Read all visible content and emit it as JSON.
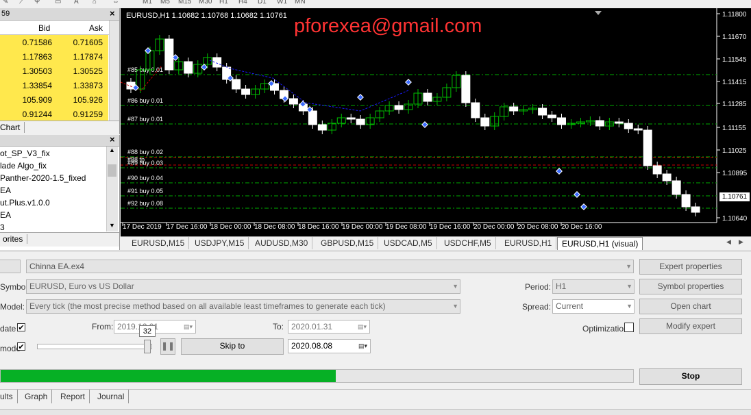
{
  "toolbar": {
    "items": [
      "M1",
      "M5",
      "M15",
      "M30",
      "H1",
      "H4",
      "D1",
      "W1",
      "MN"
    ]
  },
  "market_watch": {
    "title_fragment": "59",
    "col_bid": "Bid",
    "col_ask": "Ask",
    "rows": [
      {
        "bid": "0.71586",
        "ask": "0.71605"
      },
      {
        "bid": "1.17863",
        "ask": "1.17874"
      },
      {
        "bid": "1.30503",
        "ask": "1.30525"
      },
      {
        "bid": "1.33854",
        "ask": "1.33873"
      },
      {
        "bid": "105.909",
        "ask": "105.926"
      },
      {
        "bid": "0.91244",
        "ask": "0.91259"
      }
    ],
    "tab_label": "Chart"
  },
  "navigator": {
    "items": [
      "ot_SP_V3_fix",
      "lade Algo_fix",
      "Panther-2020-1.5_fixed",
      "EA",
      "ut.Plus.v1.0.0",
      "EA",
      "3"
    ],
    "tab_label": "orites"
  },
  "chart": {
    "header": "EURUSD,H1  1.10682 1.10768 1.10682 1.10761",
    "watermark": "pforexea@gmail.com",
    "current_price": "1.10761",
    "price_labels": [
      "1.11800",
      "1.11670",
      "1.11545",
      "1.11415",
      "1.11285",
      "1.11155",
      "1.11025",
      "1.10895",
      "1.10640"
    ],
    "time_labels": [
      "17 Dec 2019",
      "17 Dec 16:00",
      "18 Dec 00:00",
      "18 Dec 08:00",
      "18 Dec 16:00",
      "19 Dec 00:00",
      "19 Dec 08:00",
      "19 Dec 16:00",
      "20 Dec 00:00",
      "20 Dec 08:00",
      "20 Dec 16:00"
    ],
    "order_labels": [
      "#85 buy 0.01",
      "#86 buy 0.01",
      "#87 buy 0.01",
      "#88 buy 0.02",
      "#89 buy 0.03",
      "#90 buy 0.04",
      "#91 buy 0.05",
      "#92 buy 0.08",
      "#88 tp"
    ],
    "colors": {
      "bull": "#00c000",
      "bear": "#ffffff",
      "level": "#00aa00",
      "stop": "#cc0000",
      "trend": "#1a1aff"
    }
  },
  "chart_tabs": [
    "EURUSD,M15",
    "USDJPY,M15",
    "AUDUSD,M30",
    "GBPUSD,M15",
    "USDCAD,M5",
    "USDCHF,M5",
    "EURUSD,H1",
    "EURUSD,H1 (visual)"
  ],
  "tester": {
    "expert_value": "Chinna EA.ex4",
    "symbol_label": "Symbol:",
    "symbol_value": "EURUSD, Euro vs US Dollar",
    "model_label": "Model:",
    "model_value": "Every tick (the most precise method based on all available least timeframes to generate each tick)",
    "use_date_label": "date",
    "from_label": "From:",
    "from_value": "2019.12.01",
    "to_label": "To:",
    "to_value": "2020.01.31",
    "visual_label": "mode",
    "speed_tooltip": "32",
    "skip_button": "Skip to",
    "skip_date": "2020.08.08",
    "period_label": "Period:",
    "period_value": "H1",
    "spread_label": "Spread:",
    "spread_value": "Current",
    "optimization_label": "Optimization",
    "btn_expert_props": "Expert properties",
    "btn_symbol_props": "Symbol properties",
    "btn_open_chart": "Open chart",
    "btn_modify": "Modify expert",
    "btn_stop": "Stop",
    "progress": 0.53,
    "progress_color": "#06b025"
  },
  "bottom_tabs": [
    "ults",
    "Graph",
    "Report",
    "Journal"
  ]
}
